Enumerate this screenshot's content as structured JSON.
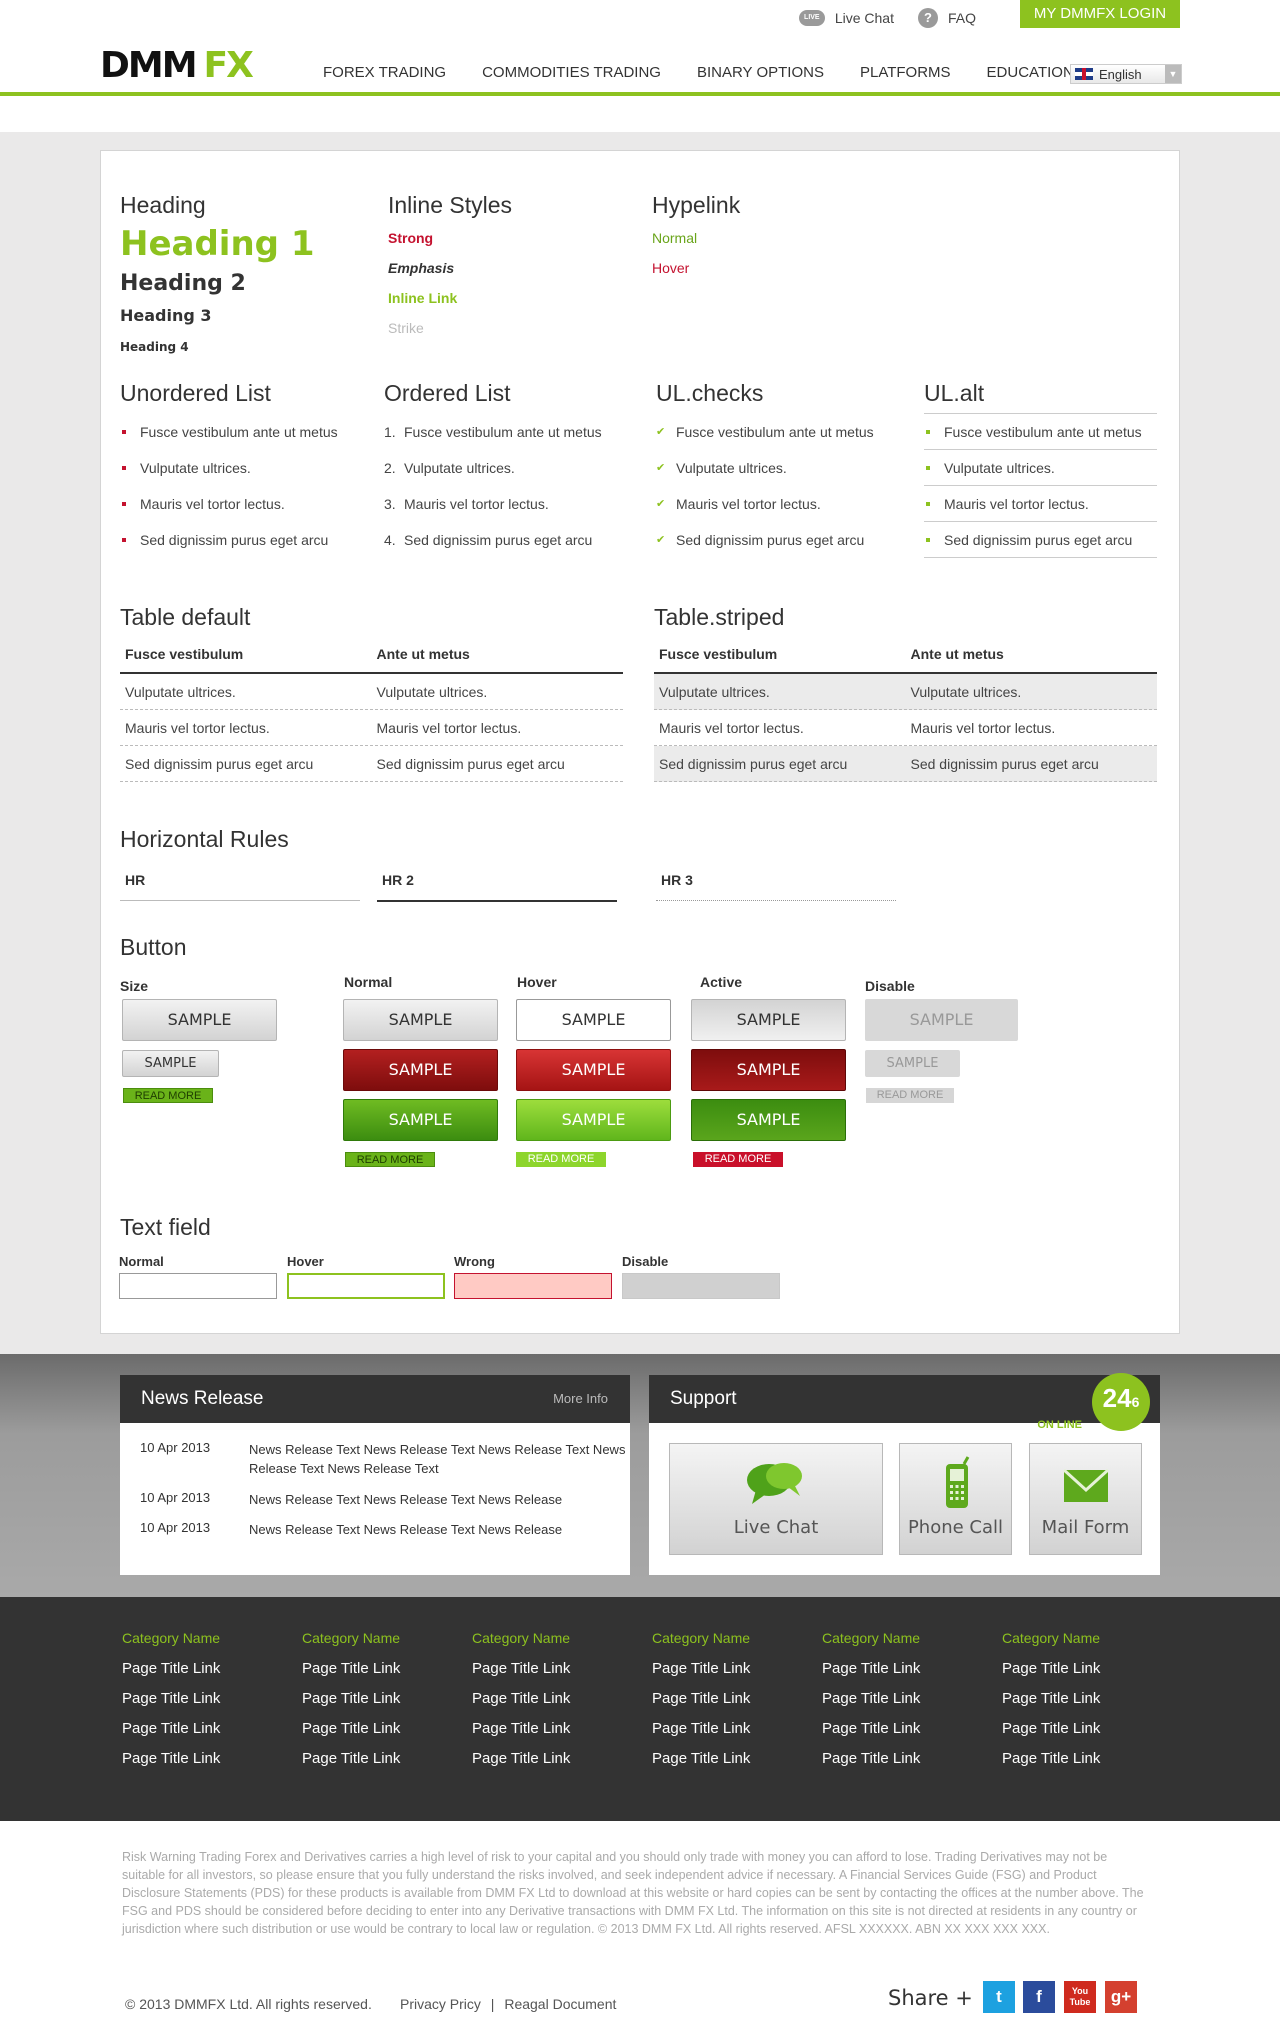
{
  "header": {
    "live_chat": "Live Chat",
    "live_badge": "LIVE",
    "faq": "FAQ",
    "login": "MY DMMFX LOGIN",
    "logo_dmm": "DMM",
    "logo_fx": "FX",
    "nav": [
      "FOREX TRADING",
      "COMMODITIES TRADING",
      "BINARY OPTIONS",
      "PLATFORMS",
      "EDUCATION"
    ],
    "language": "English"
  },
  "headings": {
    "title": "Heading",
    "h1": "Heading 1",
    "h2": "Heading 2",
    "h3": "Heading 3",
    "h4": "Heading 4"
  },
  "inline": {
    "title": "Inline Styles",
    "strong": "Strong",
    "emphasis": "Emphasis",
    "link": "Inline Link",
    "strike": "Strike"
  },
  "hyperlink": {
    "title": "Hypelink",
    "normal": "Normal",
    "hover": "Hover"
  },
  "lists": {
    "unordered_title": "Unordered List",
    "ordered_title": "Ordered List",
    "checks_title": "UL.checks",
    "alt_title": "UL.alt",
    "items": [
      "Fusce vestibulum ante ut metus",
      "Vulputate ultrices.",
      "Mauris vel tortor lectus.",
      "Sed dignissim purus eget arcu"
    ],
    "numbers": [
      "1.",
      "2.",
      "3.",
      "4."
    ]
  },
  "tables": {
    "default_title": "Table default",
    "striped_title": "Table.striped",
    "headers": [
      "Fusce vestibulum",
      "Ante ut metus"
    ],
    "rows": [
      [
        "Vulputate ultrices.",
        "Vulputate ultrices."
      ],
      [
        "Mauris vel tortor lectus.",
        "Mauris vel tortor lectus."
      ],
      [
        "Sed dignissim purus eget arcu",
        "Sed dignissim purus eget arcu"
      ]
    ]
  },
  "rules": {
    "title": "Horizontal Rules",
    "hr1": "HR",
    "hr2": "HR 2",
    "hr3": "HR 3"
  },
  "buttons": {
    "title": "Button",
    "size": "Size",
    "normal": "Normal",
    "hover": "Hover",
    "active": "Active",
    "disable": "Disable",
    "sample": "SAMPLE",
    "read_more": "READ MORE"
  },
  "textfield": {
    "title": "Text field",
    "normal": "Normal",
    "hover": "Hover",
    "wrong": "Wrong",
    "disable": "Disable"
  },
  "news": {
    "title": "News Release",
    "more": "More Info",
    "items": [
      {
        "date": "10 Apr 2013",
        "text": "News Release Text News Release Text News Release Text News Release Text News Release Text"
      },
      {
        "date": "10 Apr 2013",
        "text": "News Release Text News Release Text News Release"
      },
      {
        "date": "10 Apr 2013",
        "text": "News Release Text News Release Text News Release"
      }
    ]
  },
  "support": {
    "title": "Support",
    "online": "ON LINE",
    "badge_main": "24",
    "badge_sub": "6",
    "live_chat": "Live Chat",
    "phone_call": "Phone Call",
    "mail_form": "Mail Form"
  },
  "footer": {
    "category": "Category Name",
    "link": "Page Title Link",
    "risk": "Risk Warning Trading Forex and Derivatives carries a high level of risk to your capital and you should only trade with money you can afford to lose. Trading Derivatives may not be suitable for all investors, so please ensure that you fully understand the risks involved, and seek independent advice if necessary. A Financial Services Guide (FSG) and Product Disclosure Statements (PDS) for these products is available from DMM FX Ltd to download at this website or hard copies can be sent by contacting the offices at the number above. The FSG and PDS should be considered before deciding to enter into any Derivative transactions with DMM FX Ltd. The information on this site is not directed at residents in any country or jurisdiction where such distribution or use would be contrary to local law or regulation. © 2013 DMM FX Ltd. All rights reserved. AFSL XXXXXX. ABN XX XXX XXX XXX.",
    "copyright": "© 2013 DMMFX Ltd. All rights reserved.",
    "privacy": "Privacy Pricy",
    "sep": "|",
    "regal": "Reagal Document",
    "share": "Share +",
    "social_twitter": "t",
    "social_facebook": "f",
    "social_youtube": "You Tube",
    "social_google": "g+"
  },
  "colors": {
    "accent": "#8dc21f",
    "strong_red": "#c4122f",
    "dark": "#333333"
  }
}
